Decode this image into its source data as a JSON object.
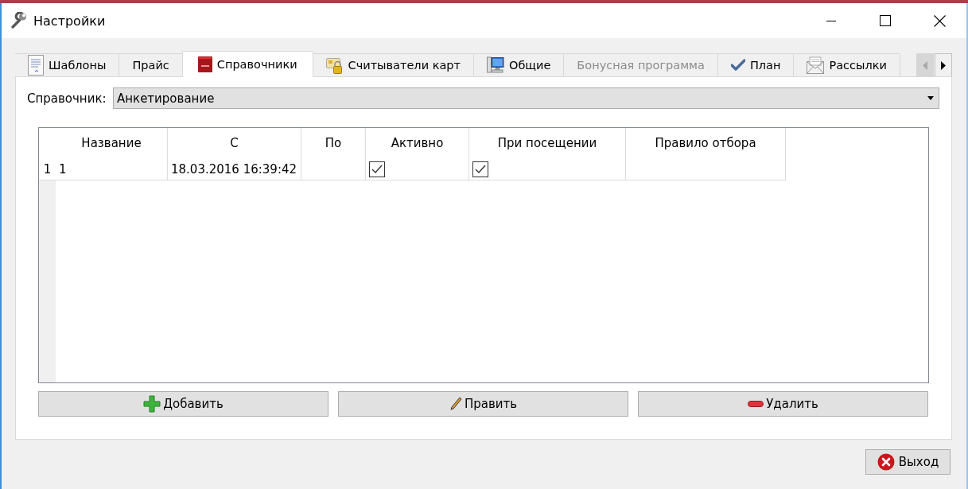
{
  "window": {
    "title": "Настройки"
  },
  "tabs": [
    {
      "label": "Шаблоны",
      "selected": false,
      "disabled": false
    },
    {
      "label": "Прайс",
      "selected": false,
      "disabled": false
    },
    {
      "label": "Справочники",
      "selected": true,
      "disabled": false
    },
    {
      "label": "Считыватели карт",
      "selected": false,
      "disabled": false
    },
    {
      "label": "Общие",
      "selected": false,
      "disabled": false
    },
    {
      "label": "Бонусная программа",
      "selected": false,
      "disabled": true
    },
    {
      "label": "План",
      "selected": false,
      "disabled": false
    },
    {
      "label": "Рассылки",
      "selected": false,
      "disabled": false
    }
  ],
  "tab_scroll": {
    "back_disabled": true,
    "forward_disabled": false
  },
  "directory": {
    "label": "Справочник:",
    "value": "Анкетирование"
  },
  "table": {
    "columns": [
      "Название",
      "С",
      "По",
      "Активно",
      "При посещении",
      "Правило отбора"
    ],
    "rows": [
      {
        "number": "1",
        "name": "1",
        "from": "18.03.2016 16:39:42",
        "active": true,
        "on_visit": true
      }
    ]
  },
  "actions": [
    {
      "label": "Добавить"
    },
    {
      "label": "Править"
    },
    {
      "label": "Удалить"
    }
  ],
  "exit_button": {
    "label": "Выход"
  }
}
